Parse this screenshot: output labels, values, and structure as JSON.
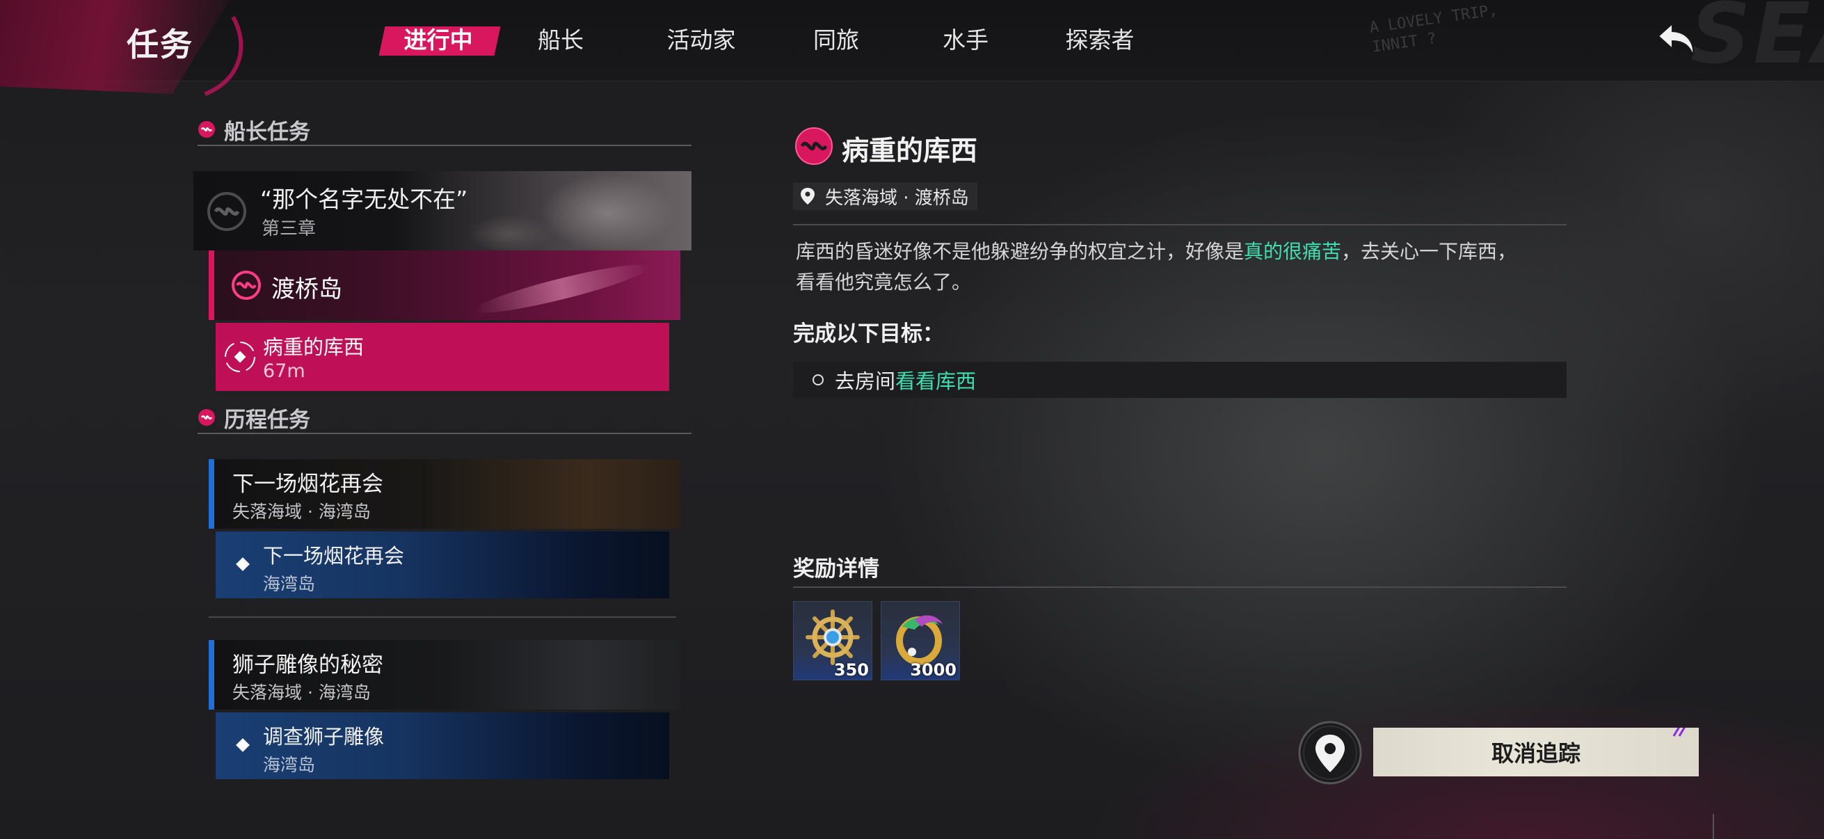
{
  "header": {
    "title": "任务",
    "tabs": [
      {
        "label": "进行中",
        "active": true
      },
      {
        "label": "船长",
        "active": false
      },
      {
        "label": "活动家",
        "active": false
      },
      {
        "label": "同旅",
        "active": false
      },
      {
        "label": "水手",
        "active": false
      },
      {
        "label": "探索者",
        "active": false
      }
    ],
    "deco_line1": "A LOVELY TRIP,",
    "deco_line2": "INNIT ?",
    "deco_brand": "SEA"
  },
  "sidebar": {
    "captain_section": "船长任务",
    "chapter": {
      "title": "“那个名字无处不在”",
      "subtitle": "第三章"
    },
    "island": "渡桥岛",
    "active_quest": {
      "name": "病重的库西",
      "distance": "67m"
    },
    "history_section": "历程任务",
    "history": [
      {
        "name": "下一场烟花再会",
        "location": "失落海域 · 海湾岛",
        "sub": {
          "name": "下一场烟花再会",
          "location": "海湾岛"
        }
      },
      {
        "name": "狮子雕像的秘密",
        "location": "失落海域 · 海湾岛",
        "sub": {
          "name": "调查狮子雕像",
          "location": "海湾岛"
        }
      }
    ]
  },
  "detail": {
    "title": "病重的库西",
    "location": "失落海域 · 渡桥岛",
    "desc_part1": "库西的昏迷好像不是他躲避纷争的权宜之计，好像是",
    "desc_highlight": "真的很痛苦",
    "desc_part2": "，去关心一下库西，",
    "desc_line2": "看看他究竟怎么了。",
    "goal_heading": "完成以下目标：",
    "goal_prefix": "去房间",
    "goal_highlight": "看看库西",
    "reward_heading": "奖励详情",
    "rewards": [
      {
        "icon": "ship-wheel-icon",
        "qty": "350"
      },
      {
        "icon": "gold-ring-icon",
        "qty": "3000"
      }
    ],
    "cancel_label": "取消追踪"
  },
  "colors": {
    "accent": "#d9175f",
    "active_quest_bg": "#be0f57",
    "highlight": "#3fe0b0",
    "history_accent": "#1f6fd6"
  }
}
